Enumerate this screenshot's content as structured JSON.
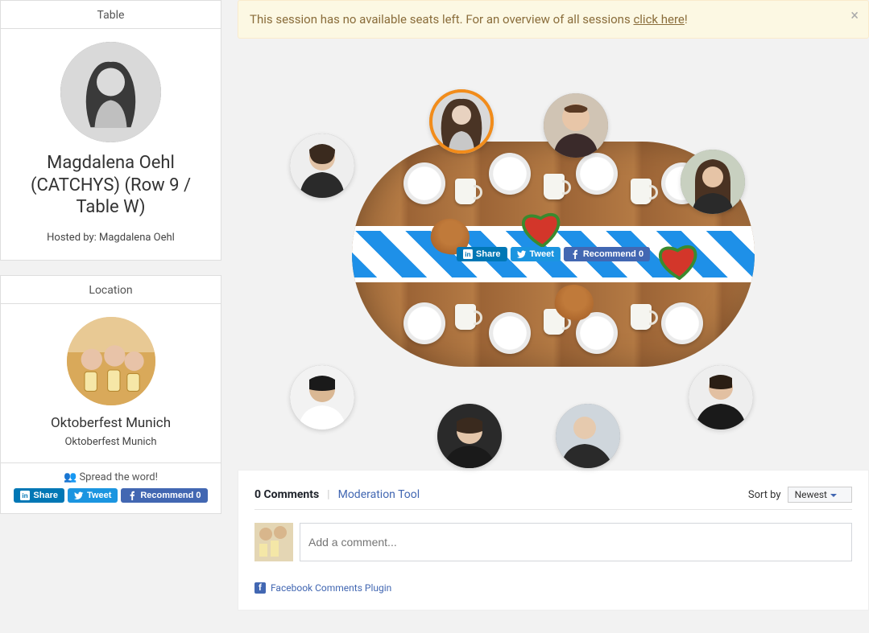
{
  "sidebar": {
    "table": {
      "header": "Table",
      "host_name": "Magdalena Oehl (CATCHYS) (Row 9 / Table W)",
      "hosted_by": "Hosted by: Magdalena Oehl"
    },
    "location": {
      "header": "Location",
      "title": "Oktoberfest Munich",
      "subtitle": "Oktoberfest Munich"
    },
    "spread": {
      "label": "Spread the word!",
      "linkedin": "Share",
      "twitter": "Tweet",
      "facebook": "Recommend 0"
    }
  },
  "alert": {
    "text_before": "This session has no available seats left. For an overview of all sessions ",
    "link_text": "click here",
    "text_after": "!"
  },
  "center_share": {
    "linkedin": "Share",
    "twitter": "Tweet",
    "facebook": "Recommend 0"
  },
  "seats": [
    {
      "name": "seat-top-left",
      "highlight": false
    },
    {
      "name": "seat-top-center",
      "highlight": true
    },
    {
      "name": "seat-top-right",
      "highlight": false
    },
    {
      "name": "seat-right",
      "highlight": false
    },
    {
      "name": "seat-bottom-right",
      "highlight": false
    },
    {
      "name": "seat-bottom-rcenter",
      "highlight": false
    },
    {
      "name": "seat-bottom-lcenter",
      "highlight": false
    },
    {
      "name": "seat-bottom-left",
      "highlight": false
    }
  ],
  "comments": {
    "count_label": "0 Comments",
    "moderation": "Moderation Tool",
    "sort_label": "Sort by",
    "sort_value": "Newest",
    "placeholder": "Add a comment...",
    "plugin_label": "Facebook Comments Plugin"
  }
}
